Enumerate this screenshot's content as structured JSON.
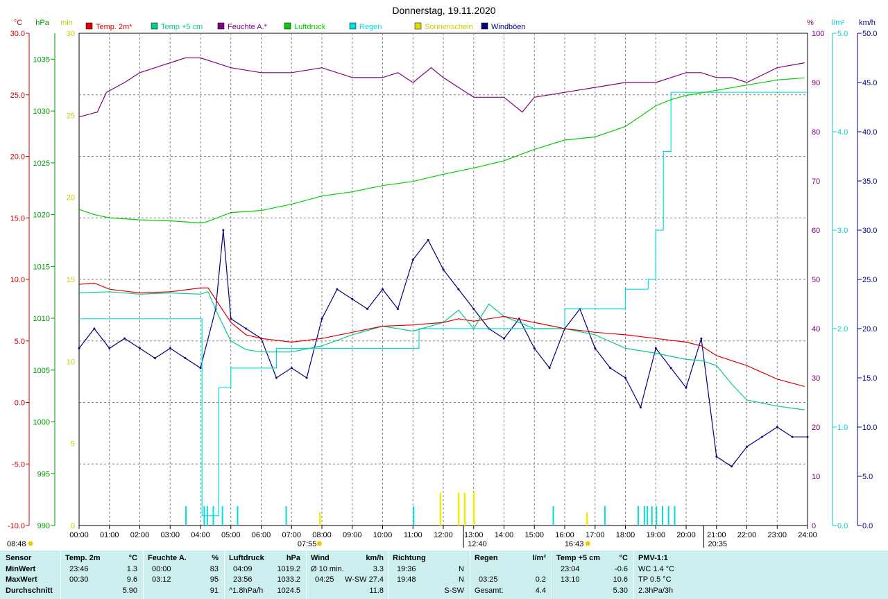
{
  "chart_data": {
    "type": "line",
    "title": "Donnerstag, 19.11.2020",
    "x_ticks": [
      "00:00",
      "01:00",
      "02:00",
      "03:00",
      "04:00",
      "05:00",
      "06:00",
      "07:00",
      "08:00",
      "09:00",
      "10:00",
      "11:00",
      "12:00",
      "13:00",
      "14:00",
      "15:00",
      "16:00",
      "17:00",
      "18:00",
      "19:00",
      "20:00",
      "21:00",
      "22:00",
      "23:00",
      "24:00"
    ],
    "axes": {
      "temp": {
        "unit": "°C",
        "range": [
          -10,
          30
        ],
        "ticks": [
          "30.0",
          "25.0",
          "20.0",
          "15.0",
          "10.0",
          "5.0",
          "0.0",
          "-5.0",
          "-10.0"
        ],
        "color": "#cc0000"
      },
      "pressure": {
        "unit": "hPa",
        "range": [
          990,
          1037.5
        ],
        "ticks": [
          "1035",
          "1030",
          "1025",
          "1020",
          "1015",
          "1010",
          "1005",
          "1000",
          "995",
          "990"
        ],
        "color": "#009900"
      },
      "sun": {
        "unit": "min",
        "range": [
          0,
          30
        ],
        "ticks": [
          "30",
          "25",
          "20",
          "15",
          "10",
          "5",
          "0"
        ],
        "color": "#cccc00"
      },
      "humidity": {
        "unit": "%",
        "range": [
          0,
          100
        ],
        "ticks": [
          "100",
          "90",
          "80",
          "70",
          "60",
          "50",
          "40",
          "30",
          "20",
          "10",
          "0"
        ],
        "color": "#800080"
      },
      "rain": {
        "unit": "l/m²",
        "range": [
          0,
          5
        ],
        "ticks": [
          "5.0",
          "4.0",
          "3.0",
          "2.0",
          "1.0",
          "0.0"
        ],
        "color": "#00cccc"
      },
      "wind": {
        "unit": "km/h",
        "range": [
          0,
          50
        ],
        "ticks": [
          "50.0",
          "45.0",
          "40.0",
          "35.0",
          "30.0",
          "25.0",
          "20.0",
          "15.0",
          "10.0",
          "5.0",
          "0.0"
        ],
        "color": "#000080"
      }
    },
    "legend": [
      {
        "name": "Temp. 2m*",
        "color": "#dd0000"
      },
      {
        "name": "Temp +5 cm",
        "color": "#00cc88"
      },
      {
        "name": "Feuchte A.*",
        "color": "#800080"
      },
      {
        "name": "Luftdruck",
        "color": "#00cc00"
      },
      {
        "name": "Regen",
        "color": "#00dddd"
      },
      {
        "name": "Sonnenschein",
        "color": "#dddd00"
      },
      {
        "name": "Windböen",
        "color": "#000080"
      }
    ],
    "series": [
      {
        "name": "Temp. 2m*",
        "axis": "temp",
        "x": [
          0,
          0.5,
          1,
          2,
          3,
          4,
          4.25,
          4.6,
          5,
          5.5,
          6,
          7,
          8,
          9,
          10,
          11,
          12,
          12.5,
          13,
          14,
          15,
          16,
          17,
          18,
          19,
          20,
          20.5,
          21,
          22,
          23,
          23.9
        ],
        "y": [
          9.6,
          9.7,
          9.2,
          8.9,
          9.0,
          9.3,
          9.3,
          8.0,
          6.5,
          5.5,
          5.2,
          4.9,
          5.2,
          5.7,
          6.2,
          6.3,
          6.5,
          6.8,
          6.6,
          7.0,
          6.5,
          6.0,
          5.7,
          5.5,
          5.2,
          4.9,
          4.6,
          3.8,
          3.0,
          1.9,
          1.3
        ]
      },
      {
        "name": "Temp +5 cm",
        "axis": "temp",
        "x": [
          0,
          1,
          2,
          3,
          4,
          4.25,
          4.6,
          5,
          5.5,
          6,
          7,
          8,
          9,
          10,
          11,
          12,
          12.5,
          13,
          13.5,
          14,
          15,
          16,
          17,
          18,
          19,
          20,
          20.5,
          21,
          21.5,
          22,
          23,
          23.9
        ],
        "y": [
          8.9,
          9.0,
          8.8,
          8.9,
          8.8,
          9.0,
          7.0,
          5.0,
          4.3,
          4.1,
          4.1,
          4.6,
          5.5,
          6.2,
          5.8,
          6.5,
          7.5,
          6.0,
          8.0,
          7.0,
          6.0,
          6.0,
          5.5,
          4.4,
          4.0,
          3.5,
          3.4,
          3.0,
          1.5,
          0.2,
          -0.3,
          -0.6
        ]
      },
      {
        "name": "Feuchte A.*",
        "axis": "humidity",
        "x": [
          0,
          0.6,
          0.9,
          1.5,
          2,
          3,
          3.5,
          4,
          4.5,
          5,
          6,
          7,
          8,
          9,
          10,
          10.5,
          11,
          11.6,
          12,
          13,
          14,
          14.6,
          15,
          16,
          17,
          18,
          19,
          20,
          20.5,
          21,
          21.5,
          22,
          23,
          23.9
        ],
        "y": [
          83,
          84,
          88,
          90,
          92,
          94,
          95,
          95,
          94,
          93,
          92,
          92,
          93,
          91,
          91,
          92,
          90,
          93,
          91,
          87,
          87,
          84,
          87,
          88,
          89,
          90,
          90,
          92,
          92,
          91,
          91,
          90,
          93,
          94
        ]
      },
      {
        "name": "Luftdruck",
        "axis": "pressure",
        "x": [
          0,
          0.5,
          1,
          2,
          3,
          4,
          4.2,
          5,
          6,
          7,
          8,
          9,
          10,
          11,
          12,
          13,
          14,
          15,
          16,
          17,
          18,
          19,
          19.5,
          20,
          21,
          22,
          23,
          23.9
        ],
        "y": [
          1020.5,
          1020.0,
          1019.7,
          1019.5,
          1019.4,
          1019.2,
          1019.3,
          1020.2,
          1020.4,
          1021.0,
          1021.8,
          1022.2,
          1022.8,
          1023.2,
          1023.9,
          1024.5,
          1025.2,
          1026.3,
          1027.2,
          1027.5,
          1028.5,
          1030.5,
          1031.1,
          1031.5,
          1032.0,
          1032.5,
          1033.0,
          1033.2
        ]
      },
      {
        "name": "Regen",
        "axis": "rain",
        "x": [
          0,
          4,
          4.05,
          4.6,
          5,
          5.25,
          5.5,
          5.8,
          6.5,
          7,
          11,
          11.2,
          12,
          12.5,
          13,
          14,
          15,
          16,
          17,
          18,
          18.75,
          19,
          19.25,
          19.5,
          24
        ],
        "y": [
          2.1,
          2.1,
          0.1,
          1.4,
          1.6,
          1.6,
          1.6,
          1.6,
          1.8,
          1.8,
          1.8,
          2.0,
          2.0,
          2.0,
          2.0,
          2.0,
          2.0,
          2.2,
          2.2,
          2.4,
          2.5,
          3.0,
          3.8,
          4.4,
          4.4
        ]
      },
      {
        "name": "Sonnenschein",
        "axis": "sun",
        "x": [
          7.93,
          11.9,
          12.5,
          12.7,
          13.0,
          16.73
        ],
        "y": [
          0.8,
          2.0,
          2.0,
          2.0,
          2.0,
          0.8
        ]
      },
      {
        "name": "Windböen",
        "axis": "wind",
        "x": [
          0,
          0.5,
          1,
          1.5,
          2,
          2.5,
          3,
          3.5,
          4,
          4.5,
          4.75,
          5,
          5.5,
          6,
          6.5,
          7,
          7.5,
          8,
          8.5,
          9,
          9.5,
          10,
          10.5,
          11,
          11.5,
          12,
          12.5,
          13,
          13.5,
          14,
          14.5,
          15,
          15.5,
          16,
          16.5,
          17,
          17.5,
          18,
          18.5,
          19,
          19.5,
          20,
          20.5,
          21,
          21.5,
          22,
          22.5,
          23,
          23.5,
          24
        ],
        "y": [
          18,
          20,
          18,
          19,
          18,
          17,
          18,
          17,
          16,
          22,
          30,
          21,
          20,
          19,
          15,
          16,
          15,
          21,
          24,
          23,
          22,
          24,
          22,
          27,
          29,
          26,
          24,
          22,
          20,
          19,
          21,
          18,
          16,
          20,
          22,
          18,
          16,
          15,
          12,
          18,
          16,
          14,
          19,
          7,
          6,
          8,
          9,
          10,
          9,
          9
        ]
      }
    ]
  },
  "markers": {
    "sunrise": "07:55",
    "sunset": "16:43",
    "moonrise": "12:40",
    "moonset": "20:35",
    "daylength": "08:48"
  },
  "summary_table": {
    "sensor": {
      "title": "Sensor",
      "rows": [
        "MinWert",
        "MaxWert",
        "Durchschnitt"
      ]
    },
    "temp2m": {
      "title": "Temp. 2m",
      "unit": "°C",
      "rows": [
        [
          "23:46",
          "1.3"
        ],
        [
          "00:30",
          "9.6"
        ],
        [
          "",
          "5.90"
        ]
      ]
    },
    "humidity": {
      "title": "Feuchte A.",
      "unit": "%",
      "rows": [
        [
          "00:00",
          "83"
        ],
        [
          "03:12",
          "95"
        ],
        [
          "",
          "91"
        ]
      ]
    },
    "pressure": {
      "title": "Luftdruck",
      "unit": "hPa",
      "rows": [
        [
          "04:09",
          "1019.2"
        ],
        [
          "23:56",
          "1033.2"
        ],
        [
          "^1.8hPa/h",
          "1024.5"
        ]
      ]
    },
    "wind": {
      "title": "Wind",
      "unit": "km/h",
      "rows": [
        [
          "Ø 10 min.",
          "",
          "3.3"
        ],
        [
          "04:25",
          "W-SW",
          "27.4"
        ],
        [
          "",
          "",
          "11.8"
        ]
      ]
    },
    "direction": {
      "title": "Richtung",
      "rows": [
        [
          "19:36",
          "N"
        ],
        [
          "19:48",
          "N"
        ],
        [
          "",
          "S-SW"
        ]
      ]
    },
    "rain": {
      "title": "Regen",
      "unit": "l/m²",
      "rows": [
        [
          "",
          ""
        ],
        [
          "03:25",
          "0.2"
        ],
        [
          "Gesamt:",
          "4.4"
        ]
      ]
    },
    "temp5cm": {
      "title": "Temp +5 cm",
      "unit": "°C",
      "rows": [
        [
          "23:04",
          "-0.6"
        ],
        [
          "13:10",
          "10.6"
        ],
        [
          "",
          "5.30"
        ]
      ]
    },
    "pmv": {
      "title": "PMV-1:1",
      "rows": [
        "WC 1.4 °C",
        "TP 0.5 °C",
        "2.3hPa/3h"
      ]
    }
  }
}
